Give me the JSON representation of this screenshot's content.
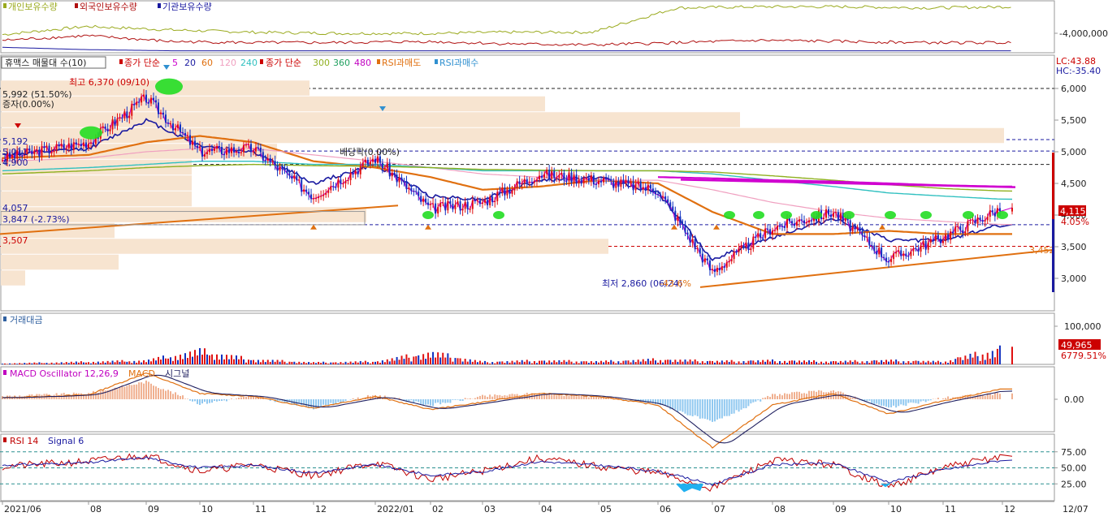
{
  "panels": {
    "holdings": {
      "legend": [
        {
          "label": "개인보유수량",
          "color": "#9aaa1e"
        },
        {
          "label": "외국인보유수량",
          "color": "#b01010"
        },
        {
          "label": "기관보유수량",
          "color": "#1a1aa0"
        }
      ],
      "axis_label": "-4,000,000"
    },
    "price": {
      "legend": [
        {
          "label": "휴맥스 매물대 수(10)",
          "color": "#222222"
        },
        {
          "label": "종가 단순",
          "color": "#cc0000"
        },
        {
          "label": "5",
          "color": "#cc00cc"
        },
        {
          "label": "20",
          "color": "#1a1aa0"
        },
        {
          "label": "60",
          "color": "#e07010"
        },
        {
          "label": "120",
          "color": "#f0a0c0"
        },
        {
          "label": "240",
          "color": "#30c0c0"
        },
        {
          "label": "종가 단순",
          "color": "#cc0000"
        },
        {
          "label": "300",
          "color": "#90b020"
        },
        {
          "label": "360",
          "color": "#20a060"
        },
        {
          "label": "480",
          "color": "#c000c0"
        },
        {
          "label": "RSI과매도",
          "color": "#e07010"
        },
        {
          "label": "RSI과매수",
          "color": "#3090d0"
        }
      ],
      "top_right": {
        "lc": "LC:43.88",
        "hc": "HC:-35.40"
      },
      "annotations": {
        "high": "최고 6,370 (09/10)",
        "low": "최저 2,860 (06/24)",
        "low_pct": "-43.6%",
        "vol_profile_max": "5,992 (51.50%)",
        "zeng_ja": "증자(0.00%)",
        "dividend": "배당락(0.00%)",
        "p5192": "5,192",
        "p5011": "5,011",
        "p4900": "4,900",
        "p4057": "4,057",
        "p3847": "3,847 (-2.73%)",
        "p3507": "3,507",
        "p3452": "3,452"
      },
      "current_price": "4,115",
      "current_pct": "4.05%"
    },
    "volume": {
      "legend": "거래대금",
      "current": "49,965",
      "current_pct": "6779.51%"
    },
    "macd": {
      "legend": [
        {
          "label": "MACD Oscillator 12,26,9",
          "color": "#c000c0"
        },
        {
          "label": "MACD",
          "color": "#e07010"
        },
        {
          "label": "시그널",
          "color": "#202060"
        }
      ]
    },
    "rsi": {
      "legend": [
        {
          "label": "RSI 14",
          "color": "#c00000"
        },
        {
          "label": "Signal 6",
          "color": "#1a1aa0"
        }
      ]
    }
  },
  "x_axis": {
    "labels": [
      "2021/06",
      "08",
      "09",
      "10",
      "11",
      "12",
      "2022/01",
      "02",
      "03",
      "04",
      "05",
      "06",
      "07",
      "08",
      "09",
      "10",
      "11",
      "12"
    ],
    "end_label": "12/07"
  },
  "chart_data": [
    {
      "type": "line",
      "title": "",
      "series": [
        {
          "name": "개인보유수량",
          "values": [
            -3.5,
            -2.8,
            -3.1,
            -3.3,
            -3.4,
            -3.4,
            -3.3,
            -3.3,
            -1.2,
            -1.1,
            -1.1,
            -1.2,
            -1.1
          ]
        },
        {
          "name": "외국인보유수량",
          "values": [
            -4.0,
            -3.6,
            -4.1,
            -4.2,
            -4.2,
            -4.1,
            -4.3,
            -4.4,
            -4.2,
            -4.0,
            -4.1,
            -4.2,
            -4.2
          ]
        },
        {
          "name": "기관보유수량",
          "values": [
            -4.6,
            -4.8,
            -4.9,
            -4.9,
            -4.9,
            -4.9,
            -4.9,
            -4.9,
            -4.9,
            -4.9,
            -4.9,
            -4.9,
            -4.9
          ]
        }
      ],
      "y_ticks": [
        "-4,000,000"
      ]
    },
    {
      "type": "line",
      "title": "",
      "y_ticks": [
        6000,
        5500,
        5000,
        4500,
        4000,
        3500,
        3000
      ],
      "ylim": [
        2500,
        6500
      ],
      "x": [
        "2021/06",
        "08",
        "09",
        "10",
        "11",
        "12",
        "2022/01",
        "02",
        "03",
        "04",
        "05",
        "06",
        "07",
        "08",
        "09",
        "10",
        "11",
        "12"
      ],
      "series": [
        {
          "name": "종가",
          "values": [
            4900,
            5150,
            5850,
            5000,
            5050,
            4300,
            4900,
            4100,
            4200,
            4650,
            4550,
            4400,
            3100,
            3800,
            4050,
            3300,
            3650,
            4115
          ]
        },
        {
          "name": "20",
          "values": [
            4950,
            5050,
            5500,
            5100,
            5000,
            4500,
            4800,
            4300,
            4250,
            4550,
            4600,
            4350,
            3300,
            3650,
            3950,
            3600,
            3600,
            3850
          ]
        },
        {
          "name": "60",
          "values": [
            4900,
            4950,
            5150,
            5250,
            5150,
            4850,
            4750,
            4600,
            4400,
            4450,
            4550,
            4500,
            4050,
            3700,
            3700,
            3750,
            3700,
            3700
          ]
        },
        {
          "name": "120",
          "values": [
            4850,
            4900,
            5000,
            5050,
            5050,
            4950,
            4850,
            4750,
            4650,
            4600,
            4550,
            4550,
            4400,
            4200,
            4050,
            3950,
            3900,
            3850
          ]
        },
        {
          "name": "240",
          "values": [
            4700,
            4750,
            4800,
            4850,
            4850,
            4800,
            4800,
            4750,
            4700,
            4700,
            4700,
            4700,
            4650,
            4550,
            4450,
            4350,
            4300,
            4250
          ]
        },
        {
          "name": "300",
          "values": [
            4650,
            4700,
            4750,
            4780,
            4800,
            4780,
            4770,
            4750,
            4720,
            4710,
            4700,
            4700,
            4680,
            4620,
            4550,
            4480,
            4420,
            4380
          ]
        },
        {
          "name": "480",
          "values": [
            null,
            null,
            null,
            null,
            null,
            null,
            null,
            null,
            null,
            null,
            null,
            4600,
            4580,
            4550,
            4530,
            4500,
            4470,
            4450
          ]
        }
      ],
      "annotations": [
        "최고 6,370 (09/10)",
        "최저 2,860 (06/24)"
      ]
    },
    {
      "type": "bar",
      "title": "",
      "y_ticks": [
        100000
      ],
      "series": [
        {
          "name": "거래대금",
          "values": [
            3000,
            8000,
            12000,
            40000,
            15000,
            6000,
            9000,
            35000,
            8000,
            12000,
            9000,
            15000,
            10000,
            12000,
            9000,
            12000,
            8000,
            49965
          ]
        }
      ]
    },
    {
      "type": "line",
      "title": "",
      "y_ticks": [
        0
      ],
      "series": [
        {
          "name": "MACD Oscillator 12,26,9",
          "values": [
            20,
            40,
            120,
            -30,
            20,
            -60,
            30,
            -40,
            20,
            40,
            20,
            -30,
            -160,
            30,
            60,
            -60,
            10,
            40
          ]
        },
        {
          "name": "MACD",
          "values": [
            10,
            30,
            180,
            40,
            20,
            -60,
            20,
            -70,
            -20,
            40,
            20,
            -40,
            -330,
            -40,
            40,
            -100,
            -10,
            70
          ]
        }
      ]
    },
    {
      "type": "line",
      "title": "",
      "y_ticks": [
        75,
        50,
        25
      ],
      "ylim": [
        0,
        100
      ],
      "series": [
        {
          "name": "RSI 14",
          "values": [
            52,
            60,
            70,
            45,
            55,
            38,
            58,
            32,
            45,
            65,
            52,
            42,
            18,
            62,
            55,
            20,
            50,
            68
          ]
        },
        {
          "name": "Signal 6",
          "values": [
            54,
            58,
            66,
            50,
            54,
            42,
            55,
            38,
            44,
            60,
            54,
            45,
            24,
            55,
            57,
            28,
            47,
            62
          ]
        }
      ]
    }
  ]
}
